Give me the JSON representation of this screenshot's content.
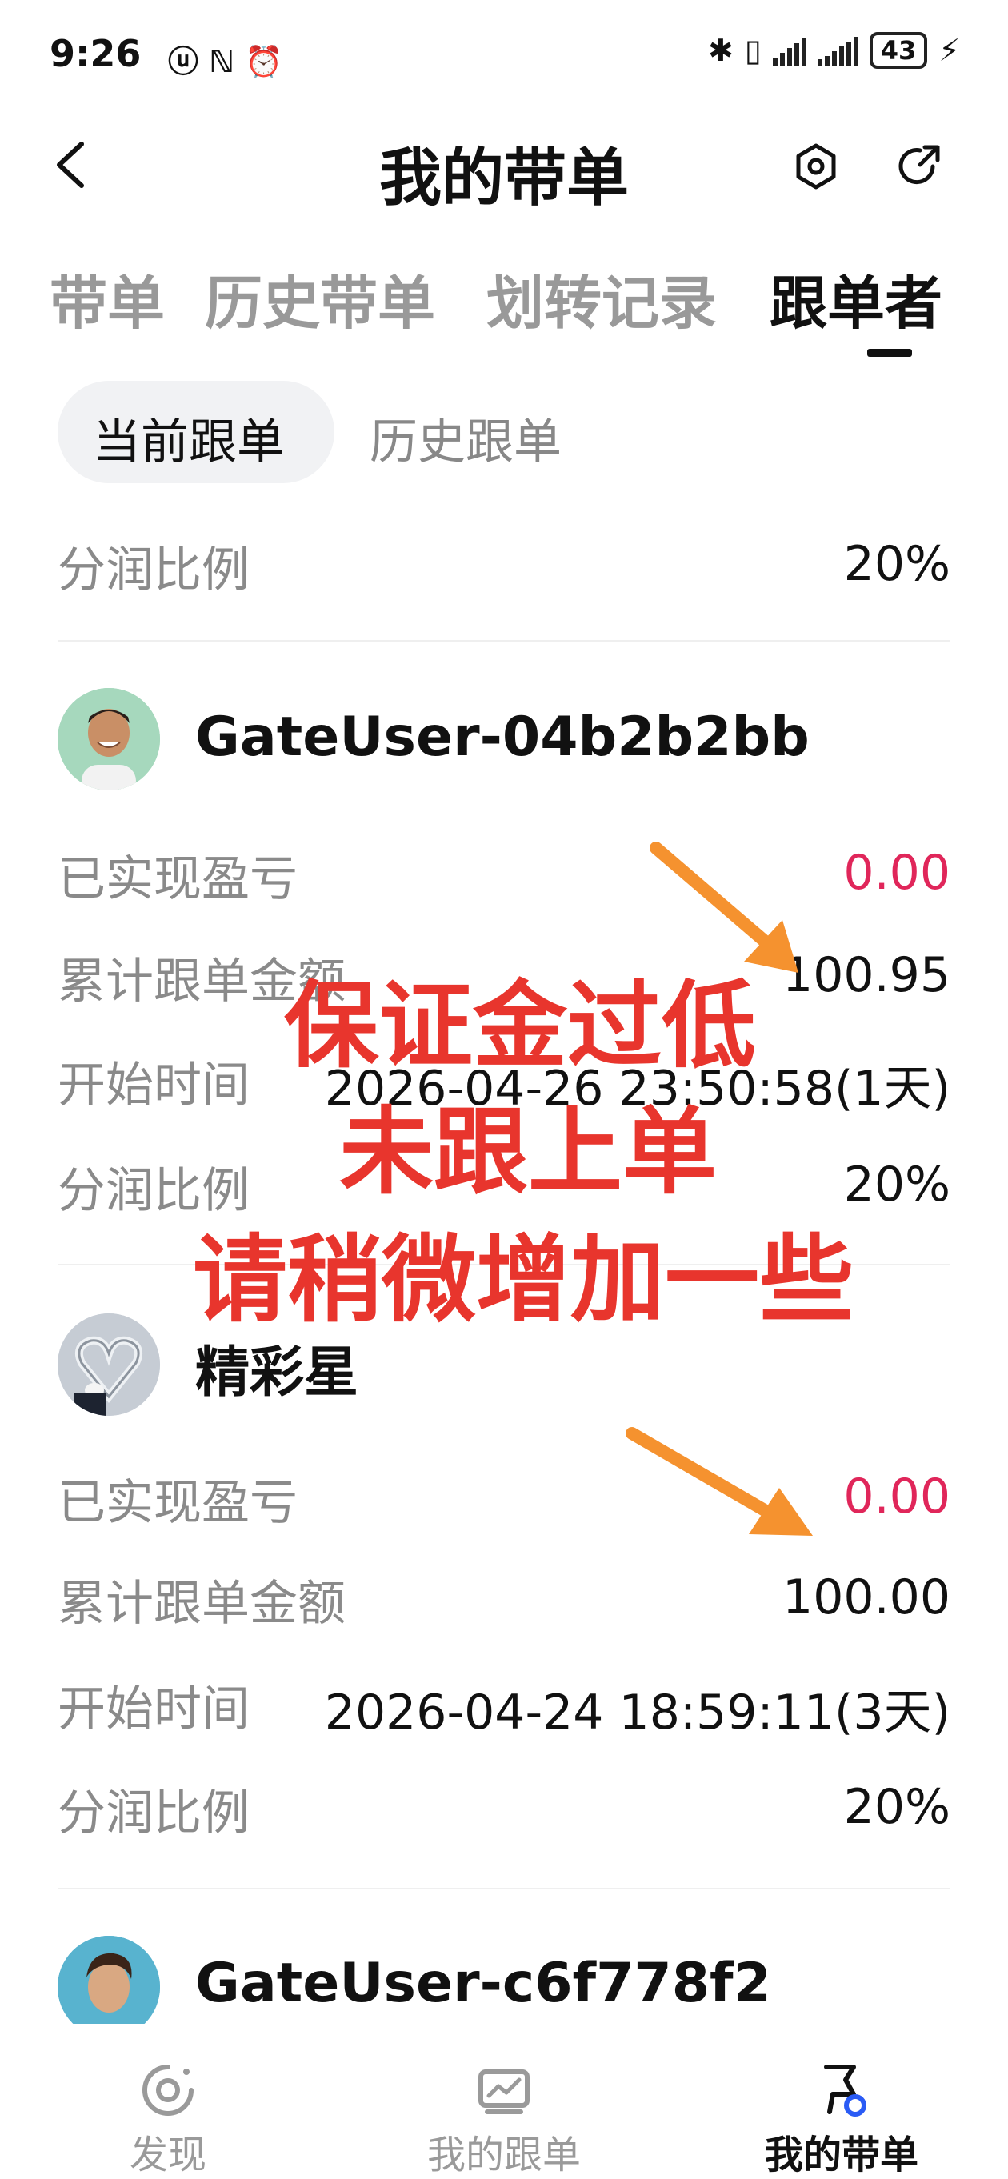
{
  "status_bar": {
    "time": "9:26",
    "left_icons": "ⓤ ℕ ⏰",
    "battery": "43"
  },
  "header": {
    "title": "我的带单",
    "back_icon": "chevron-left-icon",
    "settings_icon": "hexagon-gear-icon",
    "share_icon": "share-icon"
  },
  "tabs": [
    {
      "label": "带单",
      "active": false
    },
    {
      "label": "历史带单",
      "active": false
    },
    {
      "label": "划转记录",
      "active": false
    },
    {
      "label": "跟单者",
      "active": true
    }
  ],
  "subtabs": [
    {
      "label": "当前跟单",
      "active": true
    },
    {
      "label": "历史跟单",
      "active": false
    }
  ],
  "partial_row": {
    "label": "分润比例",
    "value": "20%"
  },
  "followers": [
    {
      "name": "GateUser-04b2b2bb",
      "realized_pnl_label": "已实现盈亏",
      "realized_pnl": "0.00",
      "total_amount_label": "累计跟单金额",
      "total_amount": "100.95",
      "start_time_label": "开始时间",
      "start_time": "2026-04-26 23:50:58(1天)",
      "profit_share_label": "分润比例",
      "profit_share": "20%"
    },
    {
      "name": "精彩星",
      "realized_pnl_label": "已实现盈亏",
      "realized_pnl": "0.00",
      "total_amount_label": "累计跟单金额",
      "total_amount": "100.00",
      "start_time_label": "开始时间",
      "start_time": "2026-04-24 18:59:11(3天)",
      "profit_share_label": "分润比例",
      "profit_share": "20%"
    },
    {
      "name": "GateUser-c6f778f2"
    }
  ],
  "overlay": {
    "line1": "保证金过低",
    "line2": "未跟上单",
    "line3": "请稍微增加一些",
    "color": "#e8352d",
    "arrow_color": "#f5922f"
  },
  "bottom_nav": [
    {
      "label": "发现",
      "icon": "discover-icon",
      "active": false
    },
    {
      "label": "我的跟单",
      "icon": "chart-icon",
      "active": false
    },
    {
      "label": "我的带单",
      "icon": "flag-badge-icon",
      "active": true
    }
  ],
  "colors": {
    "loss_red": "#e0265a",
    "label_gray": "#8a8a8a",
    "active_dot_blue": "#2a5bf5"
  }
}
